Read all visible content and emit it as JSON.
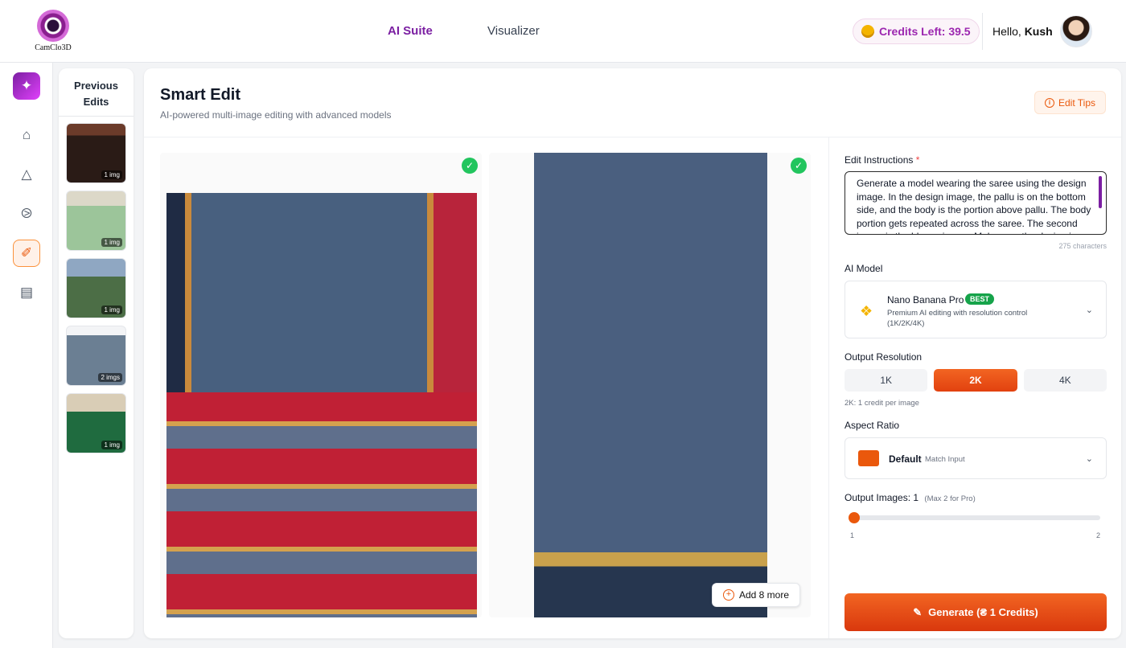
{
  "brand": {
    "name": "CamClo3D"
  },
  "nav": {
    "ai_suite": "AI Suite",
    "visualizer": "Visualizer"
  },
  "header": {
    "credits": "Credits Left: 39.5",
    "greeting": "Hello,",
    "user_name": "Kush"
  },
  "rail": {
    "items": [
      "sparkles-icon",
      "home-icon",
      "hanger-icon",
      "tag-icon",
      "magic-wand-icon",
      "gallery-icon"
    ]
  },
  "previous_edits": {
    "title_line1": "Previous",
    "title_line2": "Edits",
    "items": [
      {
        "badge": "1 img"
      },
      {
        "badge": "1 img"
      },
      {
        "badge": "1 img"
      },
      {
        "badge": "2 imgs"
      },
      {
        "badge": "1 img"
      }
    ]
  },
  "page": {
    "title": "Smart Edit",
    "subtitle": "AI-powered multi-image editing with advanced models",
    "edit_tips": "Edit Tips"
  },
  "images": {
    "add_more": "Add 8 more"
  },
  "panel": {
    "instructions_label": "Edit Instructions",
    "required_mark": "*",
    "instructions_value": "Generate a model wearing the saree using the design image. In the design image, the pallu is on the bottom side, and the body is the portion above pallu. The body portion gets repeated across the saree. The second image is the blouse image. Make sure the design is",
    "char_count": "275 characters",
    "model_label": "AI Model",
    "model_name": "Nano Banana Pro",
    "model_badge": "BEST",
    "model_desc": "Premium AI editing with resolution control (1K/2K/4K)",
    "resolution_label": "Output Resolution",
    "resolutions": [
      "1K",
      "2K",
      "4K"
    ],
    "selected_resolution": "2K",
    "resolution_hint": "2K: 1 credit per image",
    "aspect_label": "Aspect Ratio",
    "aspect_name": "Default",
    "aspect_sub": "Match Input",
    "output_label": "Output Images: 1",
    "output_max": "(Max 2 for Pro)",
    "output_min_tick": "1",
    "output_max_tick": "2",
    "output_value": 1,
    "generate": "Generate (₴ 1 Credits)"
  },
  "colors": {
    "accent": "#ea580c",
    "brand": "#7b1fa2",
    "success": "#22c55e"
  }
}
